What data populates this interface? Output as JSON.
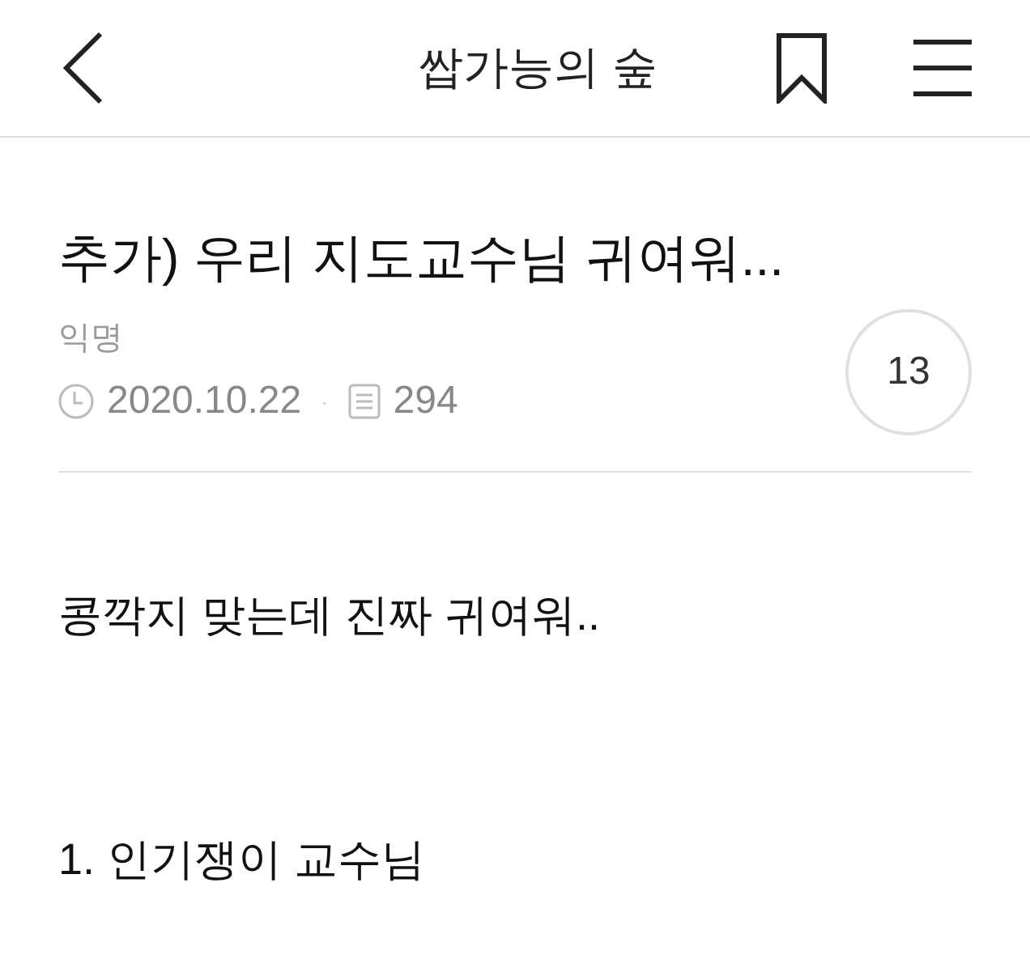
{
  "header": {
    "title": "쌉가능의 숲"
  },
  "post": {
    "title": "추가) 우리 지도교수님 귀여워...",
    "author": "익명",
    "date": "2020.10.22",
    "separator": "·",
    "views": "294",
    "comment_count": "13"
  },
  "body": [
    "콩깍지 맞는데 진짜 귀여워..",
    "1. 인기쟁이 교수님"
  ]
}
